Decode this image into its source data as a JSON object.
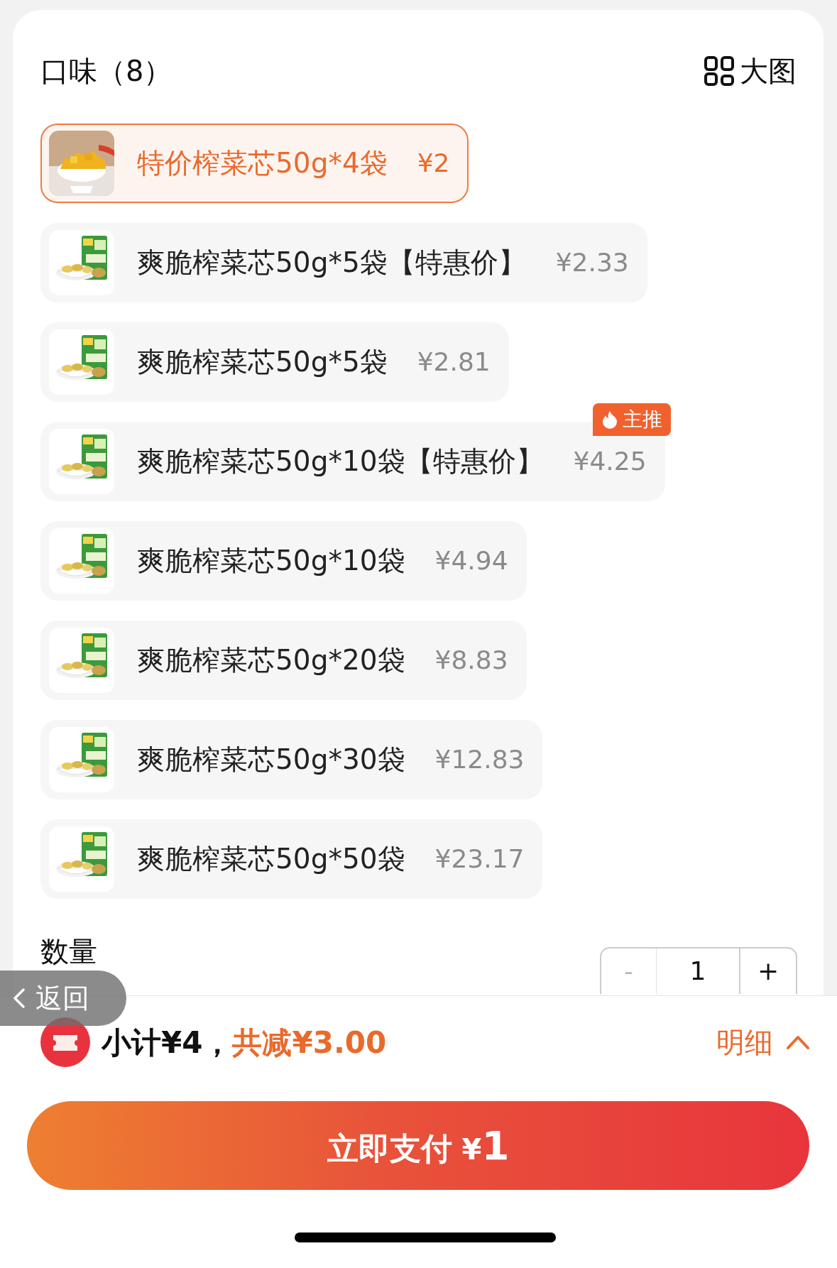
{
  "section": {
    "title": "口味（8）",
    "view_toggle": "大图"
  },
  "options": [
    {
      "name": "特价榨菜芯50g*4袋",
      "price": "¥2",
      "selected": true
    },
    {
      "name": "爽脆榨菜芯50g*5袋【特惠价】",
      "price": "¥2.33",
      "selected": false
    },
    {
      "name": "爽脆榨菜芯50g*5袋",
      "price": "¥2.81",
      "selected": false
    },
    {
      "name": "爽脆榨菜芯50g*10袋【特惠价】",
      "price": "¥4.25",
      "selected": false,
      "badge": "主推"
    },
    {
      "name": "爽脆榨菜芯50g*10袋",
      "price": "¥4.94",
      "selected": false
    },
    {
      "name": "爽脆榨菜芯50g*20袋",
      "price": "¥8.83",
      "selected": false
    },
    {
      "name": "爽脆榨菜芯50g*30袋",
      "price": "¥12.83",
      "selected": false
    },
    {
      "name": "爽脆榨菜芯50g*50袋",
      "price": "¥23.17",
      "selected": false
    }
  ],
  "quantity": {
    "label": "数量",
    "minus": "-",
    "value": "1",
    "plus": "+"
  },
  "back_button": "返回",
  "summary": {
    "subtotal": "小计¥4，",
    "discount": "共减¥3.00",
    "details": "明细"
  },
  "pay_button": {
    "label": "立即支付",
    "amount": "¥1"
  }
}
